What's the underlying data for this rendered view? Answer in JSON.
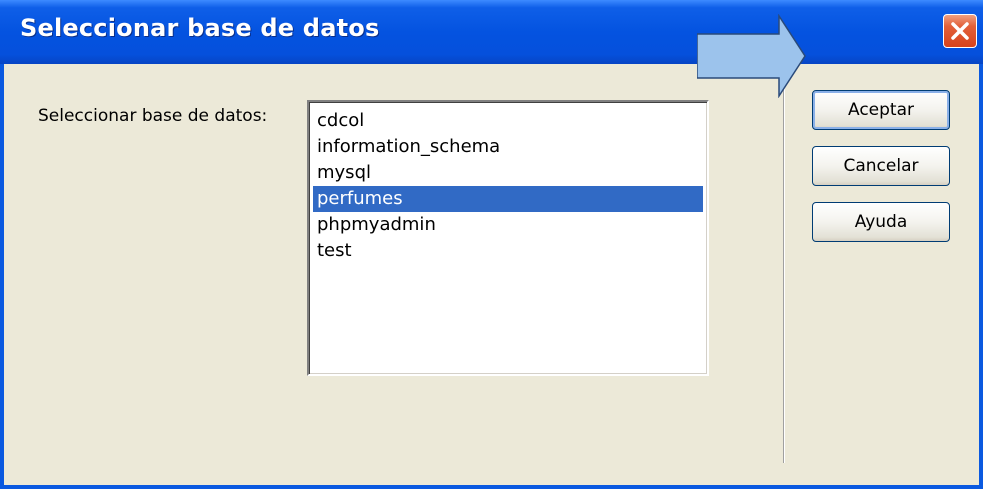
{
  "window": {
    "title": "Seleccionar base de datos",
    "close_icon": "close-icon",
    "accent_color": "#0453e0"
  },
  "form": {
    "label": "Seleccionar base de datos:",
    "databases": [
      {
        "name": "cdcol",
        "selected": false
      },
      {
        "name": "information_schema",
        "selected": false
      },
      {
        "name": "mysql",
        "selected": false
      },
      {
        "name": "perfumes",
        "selected": true
      },
      {
        "name": "phpmyadmin",
        "selected": false
      },
      {
        "name": "test",
        "selected": false
      }
    ],
    "selection_color": "#316ac5"
  },
  "buttons": {
    "accept_label": "Aceptar",
    "cancel_label": "Cancelar",
    "help_label": "Ayuda"
  },
  "annotation": {
    "arrow_icon": "arrow-right-icon",
    "arrow_color": "#9cc3ec"
  }
}
